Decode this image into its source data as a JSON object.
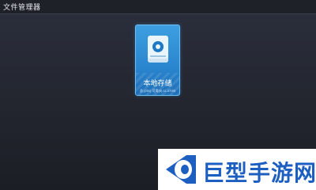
{
  "window": {
    "title": "文件管理器"
  },
  "storage_tile": {
    "label": "本地存储",
    "details": "总 (251) 可用(5) 11.47GB",
    "icon": "hard-drive-icon"
  },
  "watermark": {
    "text": "巨型手游网"
  }
}
